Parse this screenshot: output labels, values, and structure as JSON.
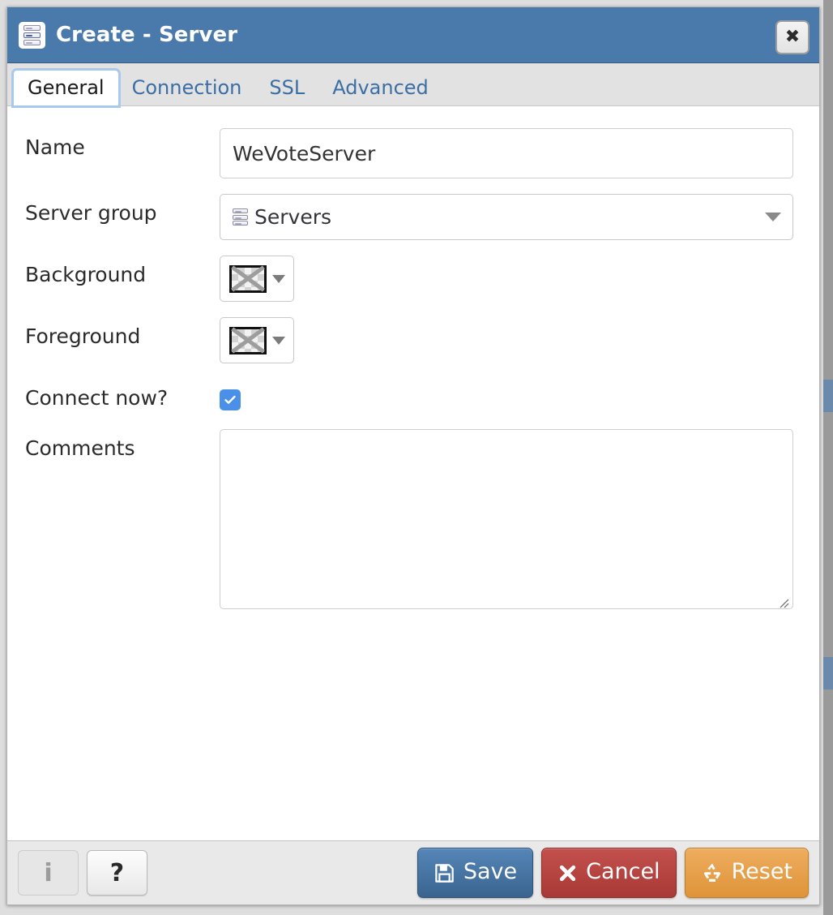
{
  "window": {
    "title": "Create - Server",
    "icon": "server-rack-icon",
    "close_label": "✖",
    "titlebar_color": "#4a7aab"
  },
  "tabs": [
    {
      "label": "General",
      "active": true
    },
    {
      "label": "Connection",
      "active": false
    },
    {
      "label": "SSL",
      "active": false
    },
    {
      "label": "Advanced",
      "active": false
    }
  ],
  "form": {
    "name": {
      "label": "Name",
      "value": "WeVoteServer",
      "placeholder": ""
    },
    "server_group": {
      "label": "Server group",
      "value": "Servers",
      "icon": "server-rack-icon",
      "caret": "chevron-down-icon"
    },
    "background": {
      "label": "Background",
      "value": "",
      "swatch": "none-checkerboard",
      "caret": "chevron-down-icon"
    },
    "foreground": {
      "label": "Foreground",
      "value": "",
      "swatch": "none-checkerboard",
      "caret": "chevron-down-icon"
    },
    "connect_now": {
      "label": "Connect now?",
      "checked": true,
      "accent": "#4a90e8"
    },
    "comments": {
      "label": "Comments",
      "value": "",
      "placeholder": ""
    }
  },
  "footer": {
    "info": {
      "label": "i",
      "icon": "info-icon",
      "disabled": true
    },
    "help": {
      "label": "?",
      "icon": "help-icon",
      "disabled": false
    },
    "save": {
      "label": "Save",
      "icon": "floppy-disk-icon",
      "color": "#3a648f"
    },
    "cancel": {
      "label": "Cancel",
      "icon": "cross-icon",
      "color": "#a93936"
    },
    "reset": {
      "label": "Reset",
      "icon": "recycle-icon",
      "color": "#df9438"
    }
  }
}
